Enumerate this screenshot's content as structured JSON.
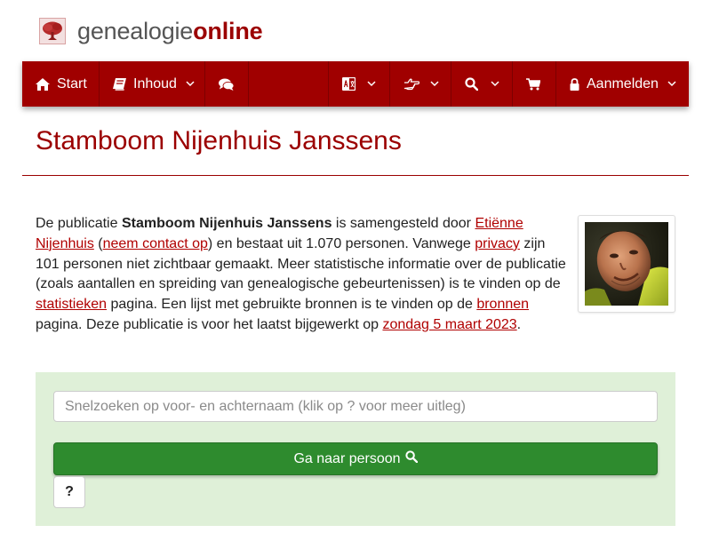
{
  "brand": {
    "part1": "genealogie",
    "part2": "online",
    "logo_icon": "tree-icon",
    "color_primary": "#9b0000",
    "color_text": "#555555"
  },
  "navbar": {
    "background": "#a00000",
    "items": [
      {
        "label": "Start",
        "icon": "home-icon"
      },
      {
        "label": "Inhoud",
        "icon": "book-icon"
      },
      {
        "label": "",
        "icon": "chat-icon"
      },
      {
        "label": "",
        "icon": "translate-icon"
      },
      {
        "label": "",
        "icon": "hand-pointer-icon"
      },
      {
        "label": "",
        "icon": "search-icon"
      },
      {
        "label": "",
        "icon": "cart-icon"
      },
      {
        "label": "Aanmelden",
        "icon": "lock-icon"
      }
    ]
  },
  "page": {
    "title": "Stamboom Nijenhuis Janssens"
  },
  "intro": {
    "t1": "De publicatie ",
    "pub_name": "Stamboom Nijenhuis Janssens",
    "t2": " is samengesteld door ",
    "author_link": "Etiënne Nijenhuis",
    "t3": " (",
    "contact_link": "neem contact op",
    "t4": ") en bestaat uit 1.070 personen. Vanwege ",
    "privacy_link": "privacy",
    "t5": " zijn 101 personen niet zichtbaar gemaakt. Meer statistische informatie over de publicatie (zoals aantallen en spreiding van genealogische gebeurtenissen) is te vinden op de ",
    "stats_link": "statistieken",
    "t6": " pagina. Een lijst met gebruikte bronnen is te vinden op de ",
    "sources_link": "bronnen",
    "t7": " pagina. Deze publicatie is voor het laatst bijgewerkt op ",
    "date_link": "zondag 5 maart 2023",
    "t8": "."
  },
  "search": {
    "placeholder": "Snelzoeken op voor- en achternaam (klik op ? voor meer uitleg)",
    "go_label": "Ga naar persoon",
    "help_label": "?",
    "panel_color": "#dff0d8",
    "button_color": "#2e8b2e"
  }
}
